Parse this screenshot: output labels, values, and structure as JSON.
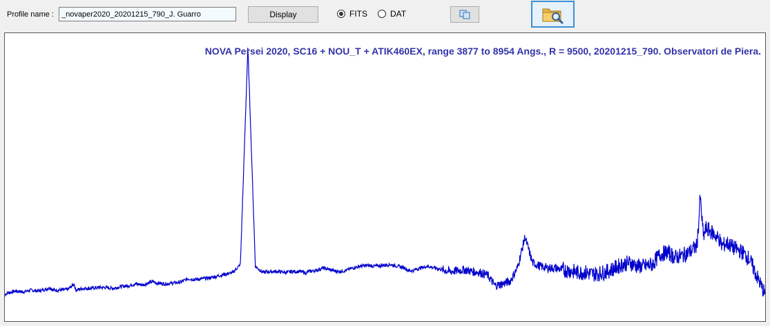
{
  "toolbar": {
    "profile_label": "Profile name :",
    "profile_value": "_novaper2020_20201215_790_J. Guarro",
    "display_label": "Display",
    "format_options": [
      {
        "label": "FITS",
        "selected": true
      },
      {
        "label": "DAT",
        "selected": false
      }
    ],
    "copy_icon": "copy-icon",
    "open_icon": "folder-search-icon"
  },
  "plot": {
    "title": "NOVA Persei 2020,  SC16 + NOU_T  + ATIK460EX, range 3877 to 8954 Angs., R = 9500,  20201215_790. Observatori de Piera.",
    "line_color": "#0000cc",
    "title_color": "#3333aa"
  },
  "chart_data": {
    "type": "line",
    "title": "NOVA Persei 2020,  SC16 + NOU_T  + ATIK460EX, range 3877 to 8954 Angs., R = 9500,  20201215_790. Observatori de Piera.",
    "xlabel": "",
    "ylabel": "",
    "xlim": [
      3877,
      8954
    ],
    "grid": false,
    "series": [
      {
        "values_description_free": true,
        "x": [
          3877,
          3900,
          3950,
          4000,
          4050,
          4100,
          4150,
          4180,
          4200,
          4250,
          4300,
          4340,
          4350,
          4400,
          4450,
          4500,
          4550,
          4600,
          4650,
          4700,
          4750,
          4800,
          4850,
          4861,
          4870,
          4880,
          4900,
          4950,
          5000,
          5050,
          5100,
          5150,
          5200,
          5250,
          5300,
          5350,
          5400,
          5450,
          5500,
          5550,
          5600,
          5650,
          5700,
          5750,
          5800,
          5850,
          5876,
          5890,
          5900,
          5950,
          6000,
          6050,
          6100,
          6150,
          6200,
          6250,
          6300,
          6350,
          6400,
          6450,
          6500,
          6550,
          6563,
          6580,
          6600,
          6650,
          6700,
          6750,
          6800,
          6850,
          6900,
          6950,
          7000,
          7050,
          7100,
          7150,
          7200,
          7250,
          7300,
          7350,
          7400,
          7450,
          7500,
          7550,
          7600,
          7650,
          7700,
          7750,
          7800,
          7850,
          7900,
          7950,
          8000,
          8050,
          8100,
          8150,
          8200,
          8250,
          8300,
          8350,
          8400,
          8450,
          8498,
          8510,
          8520,
          8542,
          8560,
          8600,
          8650,
          8662,
          8700,
          8750,
          8800,
          8850,
          8900,
          8954
        ],
        "values": [
          0.3,
          0.32,
          0.34,
          0.33,
          0.35,
          0.34,
          0.36,
          0.38,
          0.35,
          0.35,
          0.36,
          0.42,
          0.35,
          0.37,
          0.37,
          0.38,
          0.38,
          0.37,
          0.39,
          0.4,
          0.42,
          0.41,
          0.44,
          0.44,
          0.45,
          0.43,
          0.43,
          0.42,
          0.43,
          0.44,
          0.48,
          0.47,
          0.48,
          0.49,
          0.51,
          0.53,
          0.55,
          0.64,
          3.1,
          0.62,
          0.55,
          0.56,
          0.56,
          0.55,
          0.56,
          0.56,
          0.55,
          0.54,
          0.56,
          0.57,
          0.6,
          0.58,
          0.56,
          0.57,
          0.6,
          0.62,
          0.63,
          0.62,
          0.63,
          0.64,
          0.62,
          0.6,
          0.58,
          0.57,
          0.57,
          0.6,
          0.62,
          0.6,
          0.58,
          0.56,
          0.57,
          0.58,
          0.56,
          0.55,
          0.52,
          0.4,
          0.42,
          0.45,
          0.6,
          0.95,
          0.66,
          0.62,
          0.6,
          0.6,
          0.58,
          0.57,
          0.55,
          0.55,
          0.53,
          0.54,
          0.56,
          0.6,
          0.64,
          0.66,
          0.62,
          0.62,
          0.64,
          0.75,
          0.78,
          0.72,
          0.74,
          0.78,
          0.85,
          1.1,
          1.4,
          0.95,
          1.05,
          1.0,
          0.92,
          0.85,
          0.88,
          0.82,
          0.78,
          0.7,
          0.5,
          0.3
        ]
      }
    ]
  }
}
